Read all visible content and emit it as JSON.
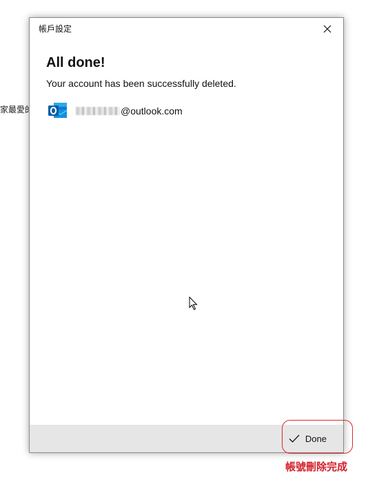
{
  "background": {
    "text": "家最愛的"
  },
  "dialog": {
    "title": "帳戶設定",
    "headline": "All done!",
    "message": "Your account has been successfully deleted.",
    "account": {
      "icon": "outlook-icon",
      "email_domain": "@outlook.com"
    },
    "footer": {
      "done_label": "Done",
      "done_icon": "checkmark-icon"
    }
  },
  "annotation": {
    "label": "帳號刪除完成",
    "color": "#d4202a"
  }
}
